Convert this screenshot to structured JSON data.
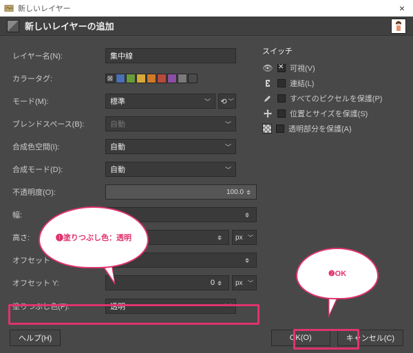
{
  "window": {
    "title": "新しいレイヤー"
  },
  "header": {
    "title": "新しいレイヤーの追加"
  },
  "fields": {
    "layer_name_label": "レイヤー名(N):",
    "layer_name_value": "集中線",
    "color_tag_label": "カラータグ:",
    "mode_label": "モード(M):",
    "mode_value": "標準",
    "blend_space_label": "ブレンドスペース(B):",
    "blend_space_value": "自動",
    "composite_space_label": "合成色空間(I):",
    "composite_space_value": "自動",
    "composite_mode_label": "合成モード(D):",
    "composite_mode_value": "自動",
    "opacity_label": "不透明度(O):",
    "opacity_value": "100.0",
    "width_label": "幅:",
    "height_label": "高さ:",
    "offset_x_label": "オフセット",
    "offset_x_value": "",
    "offset_y_label": "オフセット Y:",
    "offset_y_value": "0",
    "unit_px": "px",
    "fill_label": "塗りつぶし色(F):",
    "fill_value": "透明"
  },
  "color_swatches": [
    "#4a6fb3",
    "#6a9b3a",
    "#d6a93a",
    "#cf7a2b",
    "#b84a3a",
    "#8b4fa3",
    "#7a7a7a",
    "#4a4a4a"
  ],
  "switches": {
    "title": "スイッチ",
    "items": [
      {
        "icon": "eye",
        "label": "可視(V)",
        "checked": true
      },
      {
        "icon": "link",
        "label": "連結(L)",
        "checked": false
      },
      {
        "icon": "brush",
        "label": "すべてのピクセルを保護(P)",
        "checked": false
      },
      {
        "icon": "move",
        "label": "位置とサイズを保護(S)",
        "checked": false
      },
      {
        "icon": "alpha",
        "label": "透明部分を保護(A)",
        "checked": false
      }
    ]
  },
  "callouts": {
    "fill": "❶塗りつぶし色：透明",
    "ok": "❷OK"
  },
  "buttons": {
    "help": "ヘルプ(H)",
    "ok": "OK(O)",
    "cancel": "キャンセル(C)"
  }
}
